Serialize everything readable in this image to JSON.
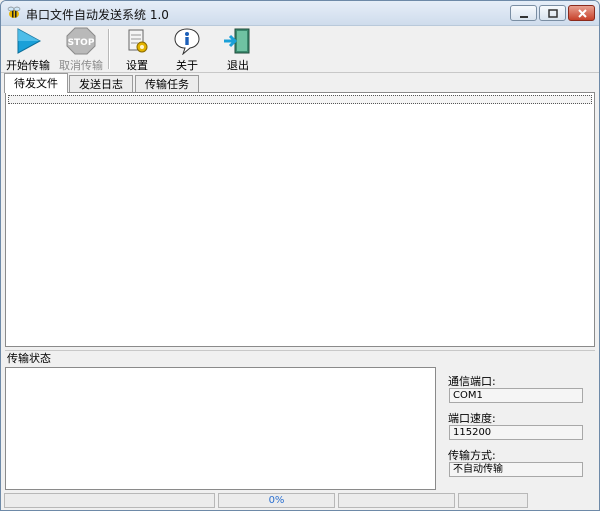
{
  "window": {
    "title": "串口文件自动发送系统 1.0"
  },
  "toolbar": {
    "start_label": "开始传输",
    "cancel_label": "取消传输",
    "settings_label": "设置",
    "about_label": "关于",
    "exit_label": "退出"
  },
  "tabs": {
    "pending": "待发文件",
    "log": "发送日志",
    "tasks": "传输任务"
  },
  "status": {
    "section_title": "传输状态",
    "port_label": "通信端口:",
    "port_value": "COM1",
    "speed_label": "端口速度:",
    "speed_value": "115200",
    "mode_label": "传输方式:",
    "mode_value": "不自动传输"
  },
  "statusbar": {
    "progress_text": "0%",
    "progress": 0
  },
  "colors": {
    "start_icon": "#1aa0d8",
    "stop_icon": "#b9b9b9",
    "progress_text": "#2a6fd0"
  },
  "icons": [
    "bee-app-icon",
    "play-icon",
    "stop-icon",
    "settings-icon",
    "info-icon",
    "exit-door-icon"
  ]
}
